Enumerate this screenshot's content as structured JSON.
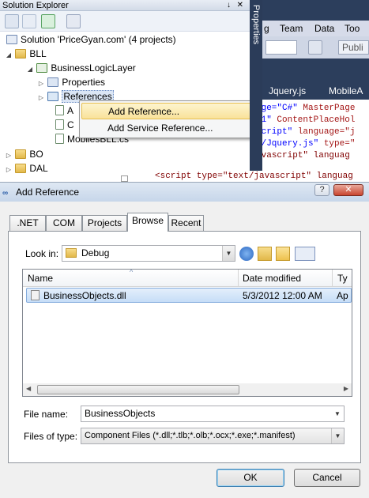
{
  "solution_explorer": {
    "title": "Solution Explorer",
    "pin_glyph": "↓",
    "close_glyph": "✕",
    "tree": {
      "solution": "Solution 'PriceGyan.com' (4 projects)",
      "bll": "BLL",
      "project": "BusinessLogicLayer",
      "properties": "Properties",
      "references": "References",
      "file_a": "A",
      "file_c": "C",
      "mobiles": "MobilesBLL.cs",
      "bo": "BO",
      "dal": "DAL"
    }
  },
  "context_menu": {
    "add_reference": "Add Reference...",
    "add_service_reference": "Add Service Reference..."
  },
  "vs_editor": {
    "properties_tab": "Properties",
    "menu": [
      "g",
      "Team",
      "Data",
      "Too"
    ],
    "tabs": [
      "Jquery.js",
      "MobileA"
    ],
    "toolbar_text": "Publi",
    "code_lines": [
      {
        "a": "age=\"C#\" ",
        "b": "MasterPage"
      },
      {
        "a": "t1\" ",
        "b": "ContentPlaceHol"
      },
      {
        "a": "script\" ",
        "b": "language=\"j"
      },
      {
        "a": "s/Jquery.js\" ",
        "b": "type=\""
      },
      {
        "a": "",
        "b": "<script type=\"text/javascript\" languag"
      }
    ]
  },
  "add_reference_dialog": {
    "title": "Add Reference",
    "controls": {
      "minimize": "?",
      "close": "✕"
    },
    "tabs": [
      ".NET",
      "COM",
      "Projects",
      "Browse",
      "Recent"
    ],
    "selected_tab": "Browse",
    "look_in_label": "Look in:",
    "look_in_value": "Debug",
    "columns": {
      "name": "Name",
      "date_modified": "Date modified",
      "type": "Ty"
    },
    "files": [
      {
        "name": "BusinessObjects.dll",
        "date": "5/3/2012 12:00 AM",
        "type": "Ap"
      }
    ],
    "file_name_label": "File name:",
    "file_name_value": "BusinessObjects",
    "files_of_type_label": "Files of type:",
    "files_of_type_value": "Component Files (*.dll;*.tlb;*.olb;*.ocx;*.exe;*.manifest)",
    "ok_label": "OK",
    "cancel_label": "Cancel"
  },
  "colors": {
    "vs_dark": "#2c3e5c",
    "highlight": "#f9e29a",
    "selection": "#c6ddf7"
  }
}
